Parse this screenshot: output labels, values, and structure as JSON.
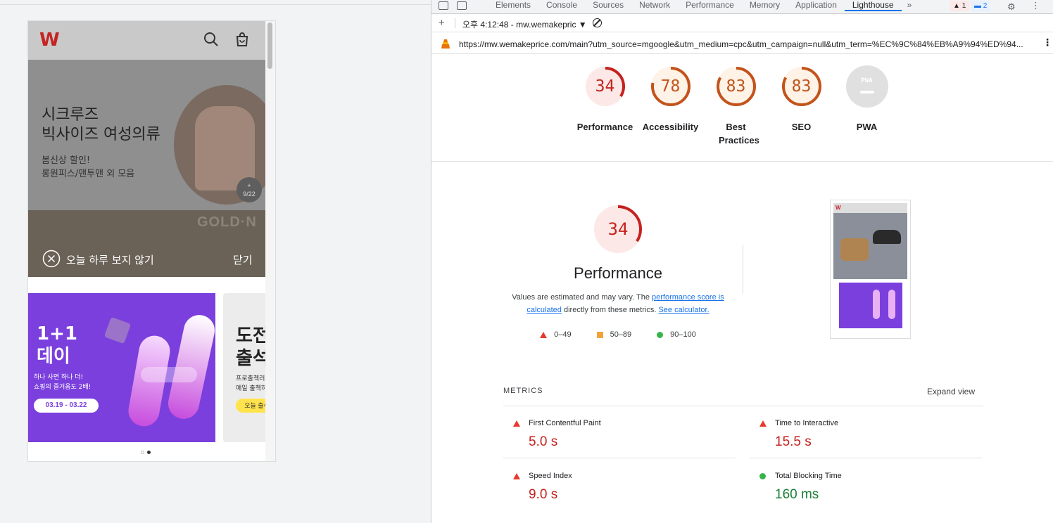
{
  "mobile": {
    "logo": "W",
    "hero_title_1": "시크루즈",
    "hero_title_2": "빅사이즈 여성의류",
    "hero_sub_1": "봄신상 할인!",
    "hero_sub_2": "롱원피스/맨투맨 외 모음",
    "hero_badge_plus": "+",
    "hero_badge_page": "9/22",
    "promo_gold": "GOLD·N",
    "dismiss_label": "오늘 하루 보지 않기",
    "close_label": "닫기",
    "card1": {
      "title_1": "1+1",
      "title_2": "데이",
      "sub_1": "하나 사면 하나 더!",
      "sub_2": "쇼핑의 즐거움도 2배!",
      "dates": "03.19 - 03.22"
    },
    "card2": {
      "title_1": "도전",
      "title_2": "출석",
      "sub_1": "프로출첵러",
      "sub_2": "매일 출첵하",
      "pill": "오늘 출석"
    }
  },
  "devtools": {
    "tabs": [
      "Elements",
      "Console",
      "Sources",
      "Network",
      "Performance",
      "Memory",
      "Application",
      "Lighthouse"
    ],
    "active_tab": "Lighthouse",
    "more_tabs": "»",
    "error_count": "1",
    "message_count": "2",
    "report_label": "오후 4:12:48 - mw.wemakepric ▼",
    "url": "https://mw.wemakeprice.com/main?utm_source=mgoogle&utm_medium=cpc&utm_campaign=null&utm_term=%EC%9C%84%EB%A9%94%ED%94...",
    "categories": [
      {
        "score": "34",
        "label": "Performance",
        "value": 34,
        "color": "#c5221f",
        "track": "#fce8e6"
      },
      {
        "score": "78",
        "label": "Accessibility",
        "value": 78,
        "color": "#c3531b",
        "track": "#fef3e6"
      },
      {
        "score": "83",
        "label": "Best Practices",
        "value": 83,
        "color": "#c3531b",
        "track": "#fef3e6"
      },
      {
        "score": "83",
        "label": "SEO",
        "value": 83,
        "color": "#c3531b",
        "track": "#fef3e6"
      },
      {
        "score": "PWA",
        "label": "PWA",
        "value": 0,
        "color": "#9aa0a6",
        "track": "#e0e0e0"
      }
    ],
    "performance": {
      "score": "34",
      "value": 34,
      "title": "Performance",
      "desc_1": "Values are estimated and may vary. The ",
      "desc_link_1": "performance score is calculated",
      "desc_2": " directly from these metrics. ",
      "desc_link_2": "See calculator.",
      "legend": [
        "0–49",
        "50–89",
        "90–100"
      ]
    },
    "metrics_heading": "METRICS",
    "expand_view": "Expand view",
    "metrics": [
      {
        "label": "First Contentful Paint",
        "value": "5.0 s",
        "status": "fail"
      },
      {
        "label": "Time to Interactive",
        "value": "15.5 s",
        "status": "fail"
      },
      {
        "label": "Speed Index",
        "value": "9.0 s",
        "status": "fail"
      },
      {
        "label": "Total Blocking Time",
        "value": "160 ms",
        "status": "pass"
      }
    ],
    "colors": {
      "fail": "#c5221f",
      "average": "#c3531b",
      "pass": "#188038",
      "accent": "#1a73e8"
    }
  }
}
